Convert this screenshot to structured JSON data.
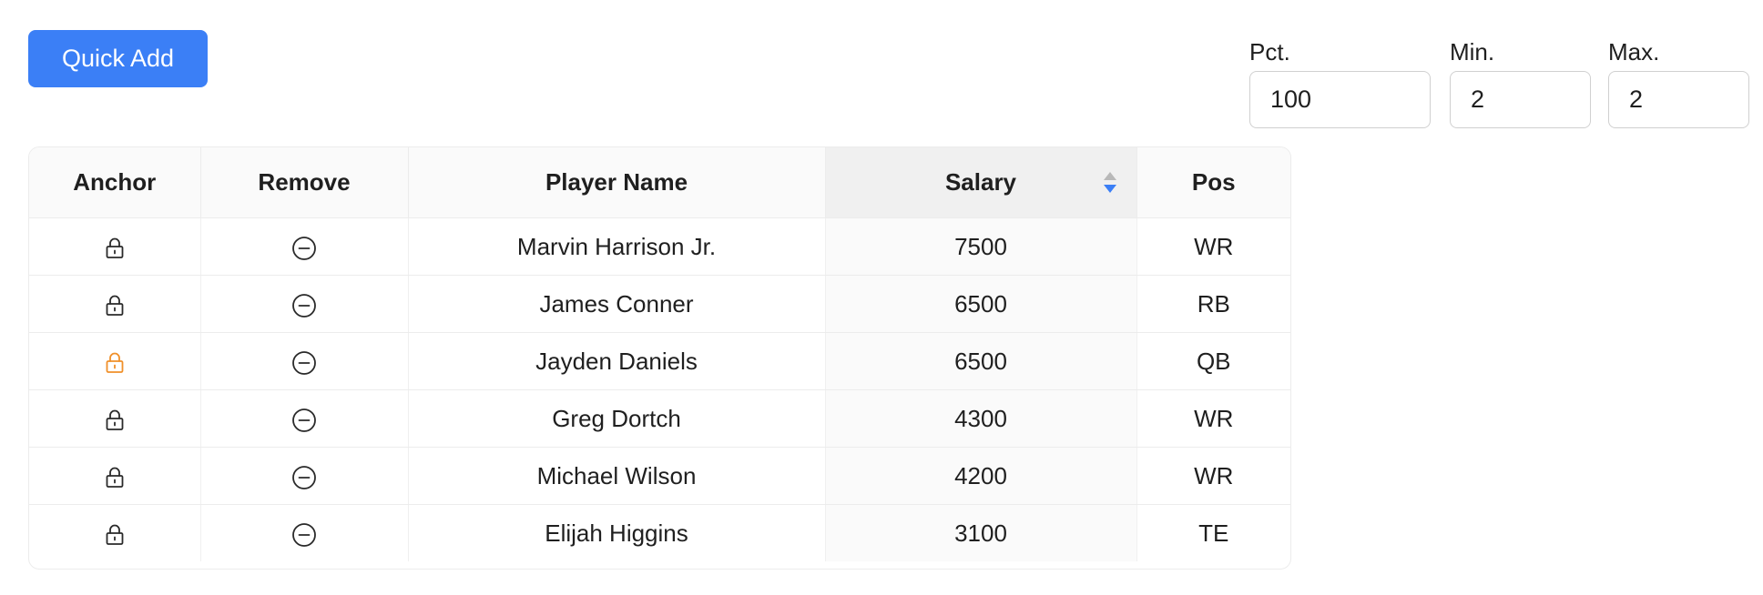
{
  "toolbar": {
    "quick_add_label": "Quick Add"
  },
  "fields": {
    "pct": {
      "label": "Pct.",
      "value": "100"
    },
    "min": {
      "label": "Min.",
      "value": "2"
    },
    "max": {
      "label": "Max.",
      "value": "2"
    }
  },
  "table": {
    "columns": [
      {
        "key": "anchor",
        "label": "Anchor"
      },
      {
        "key": "remove",
        "label": "Remove"
      },
      {
        "key": "name",
        "label": "Player Name"
      },
      {
        "key": "salary",
        "label": "Salary",
        "sorted": "descending"
      },
      {
        "key": "pos",
        "label": "Pos"
      }
    ],
    "rows": [
      {
        "name": "Marvin Harrison Jr.",
        "salary": "7500",
        "pos": "WR",
        "anchored": false
      },
      {
        "name": "James Conner",
        "salary": "6500",
        "pos": "RB",
        "anchored": false
      },
      {
        "name": "Jayden Daniels",
        "salary": "6500",
        "pos": "QB",
        "anchored": true
      },
      {
        "name": "Greg Dortch",
        "salary": "4300",
        "pos": "WR",
        "anchored": false
      },
      {
        "name": "Michael Wilson",
        "salary": "4200",
        "pos": "WR",
        "anchored": false
      },
      {
        "name": "Elijah Higgins",
        "salary": "3100",
        "pos": "TE",
        "anchored": false
      }
    ]
  },
  "icons": {
    "anchor": "lock-icon",
    "remove": "minus-circle-icon",
    "sort": "sort-icon"
  },
  "colors": {
    "accent": "#3b7ff6",
    "anchored": "#f0902a",
    "icon_default": "#2a2a2a",
    "sort_active": "#3b7ff6",
    "sort_inactive": "#b8b8b8"
  }
}
